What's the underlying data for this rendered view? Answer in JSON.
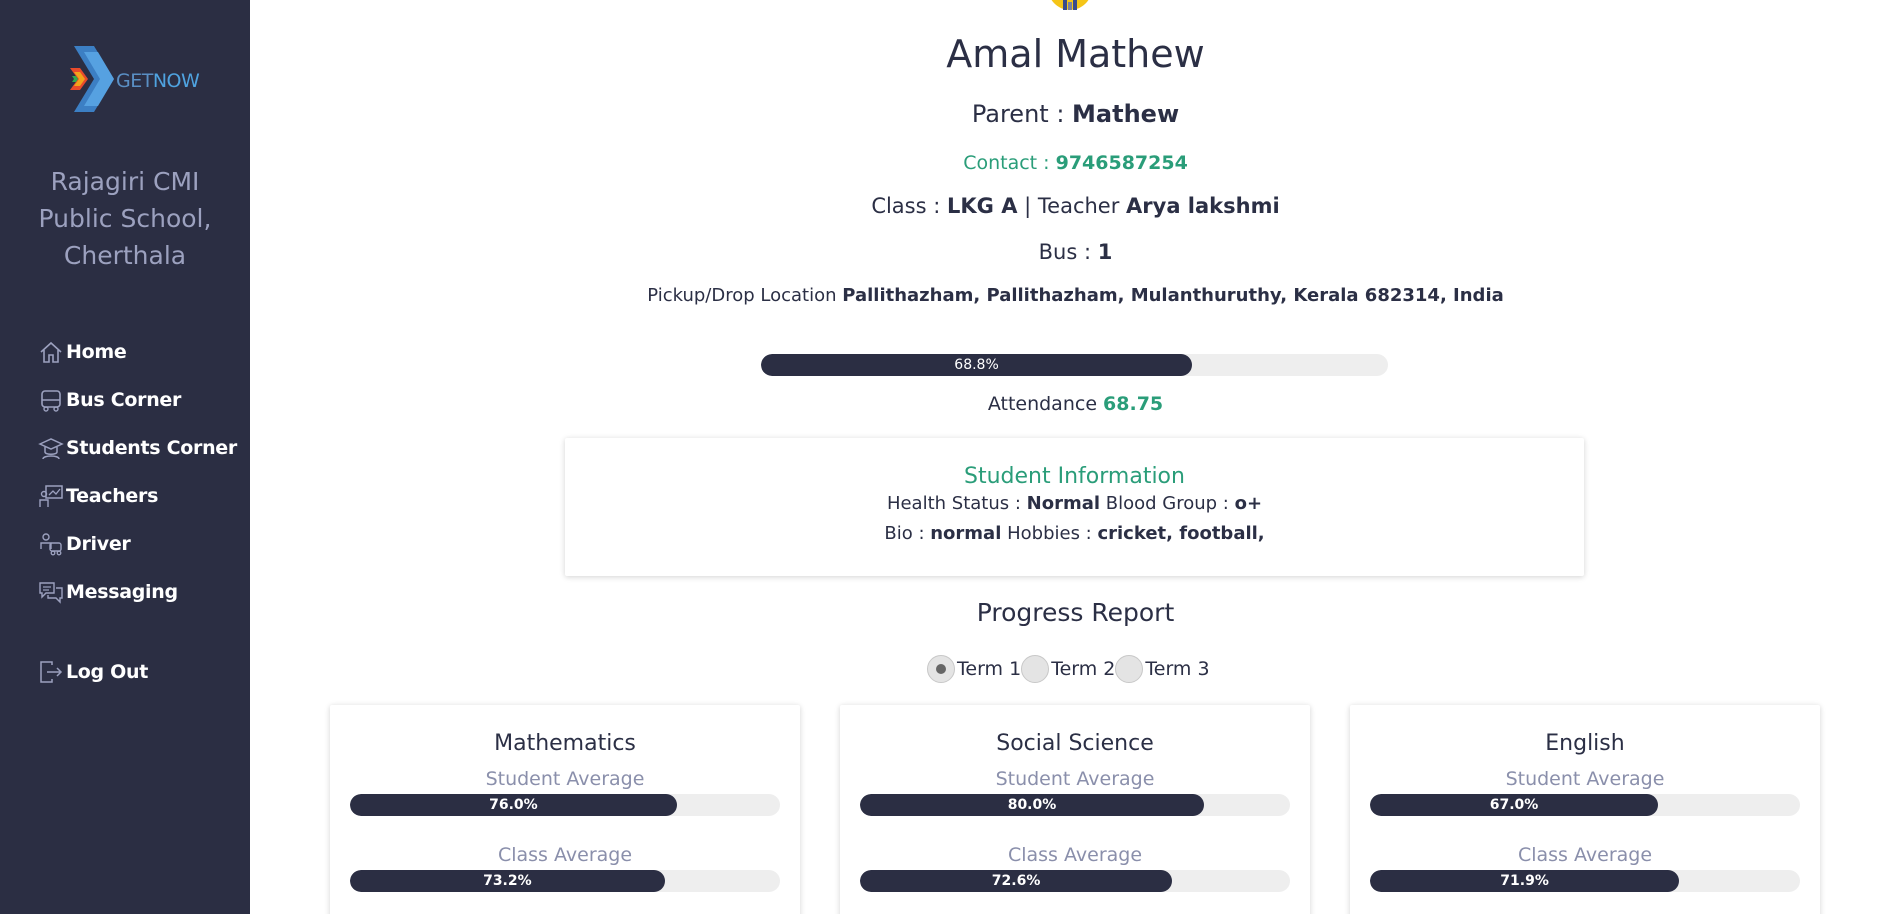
{
  "sidebar": {
    "logo": {
      "part1": "GET",
      "part2": "NOW"
    },
    "school": "Rajagiri CMI Public School, Cherthala",
    "items": [
      {
        "label": "Home",
        "icon": "home-icon"
      },
      {
        "label": "Bus Corner",
        "icon": "bus-icon"
      },
      {
        "label": "Students Corner",
        "icon": "graduate-icon"
      },
      {
        "label": "Teachers",
        "icon": "teacher-board-icon"
      },
      {
        "label": "Driver",
        "icon": "driver-icon"
      },
      {
        "label": "Messaging",
        "icon": "chat-icon"
      }
    ],
    "logout": {
      "label": "Log Out",
      "icon": "logout-icon"
    }
  },
  "student": {
    "name": "Amal Mathew",
    "parent_label": "Parent : ",
    "parent": "Mathew",
    "contact_label": "Contact : ",
    "contact": "9746587254",
    "class_label": "Class : ",
    "class": "LKG A",
    "teacher_label": " | Teacher ",
    "teacher": "Arya lakshmi",
    "bus_label": "Bus : ",
    "bus": "1",
    "location_label": "Pickup/Drop Location ",
    "location": "Pallithazham, Pallithazham, Mulanthuruthy, Kerala 682314, India"
  },
  "attendance": {
    "bar_text": "68.8%",
    "percent": 68.75,
    "label": "Attendance ",
    "value": "68.75"
  },
  "info": {
    "title": "Student Information",
    "health_label": "Health Status : ",
    "health": "Normal",
    "blood_label": " Blood Group : ",
    "blood": "o+",
    "bio_label": "Bio : ",
    "bio": "normal",
    "hobbies_label": " Hobbies : ",
    "hobbies": "cricket, football,"
  },
  "progress": {
    "title": "Progress Report",
    "terms": [
      "Term 1",
      "Term 2",
      "Term 3"
    ],
    "selected_term": "Term 1",
    "student_avg_label": "Student Average",
    "class_avg_label": "Class Average",
    "subjects": [
      {
        "name": "Mathematics",
        "student_avg": 76.0,
        "student_avg_text": "76.0%",
        "class_avg": 73.2,
        "class_avg_text": "73.2%"
      },
      {
        "name": "Social Science",
        "student_avg": 80.0,
        "student_avg_text": "80.0%",
        "class_avg": 72.6,
        "class_avg_text": "72.6%"
      },
      {
        "name": "English",
        "student_avg": 67.0,
        "student_avg_text": "67.0%",
        "class_avg": 71.9,
        "class_avg_text": "71.9%"
      }
    ]
  },
  "colors": {
    "sidebar_bg": "#2b2e43",
    "accent_green": "#2a9d79",
    "bar_fill": "#2b2e43"
  }
}
